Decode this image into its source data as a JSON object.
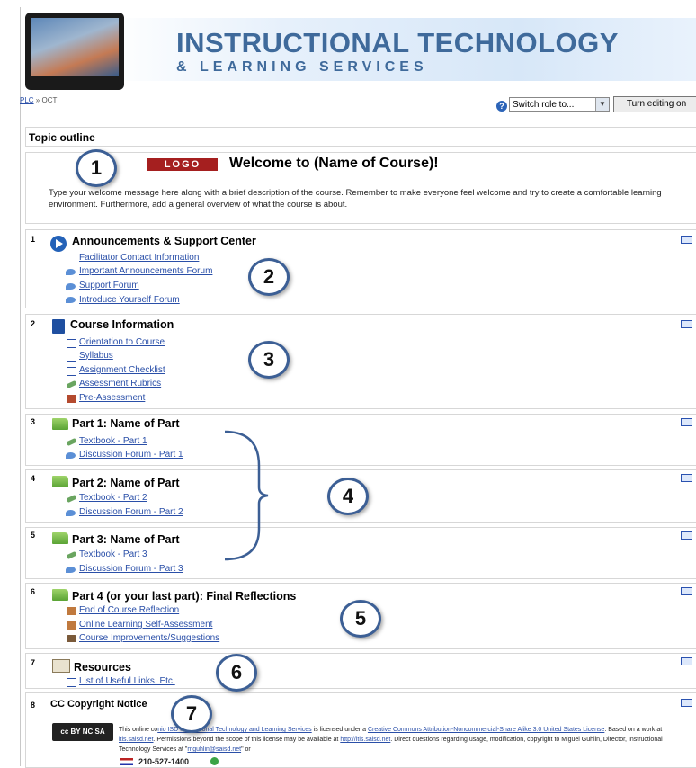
{
  "header": {
    "title_line1": "INSTRUCTIONAL TECHNOLOGY",
    "title_line2": "& LEARNING SERVICES"
  },
  "breadcrumb": {
    "items": [
      "PLC",
      "»",
      "OCT"
    ]
  },
  "toolbar": {
    "help_icon": "?",
    "role_select_value": "Switch role to...",
    "turn_editing_label": "Turn editing on"
  },
  "outline_title": "Topic outline",
  "welcome": {
    "logo_text": "LOGO",
    "title": "Welcome to (Name of Course)!",
    "message": "Type your welcome message here along with a brief description of the course. Remember to make everyone feel welcome and try to create a comfortable learning environment. Furthermore, add a general overview of what the course is about."
  },
  "badges": [
    "1",
    "2",
    "3",
    "4",
    "5",
    "6",
    "7"
  ],
  "sections": [
    {
      "num": "1",
      "title": "Announcements & Support Center",
      "items": [
        "Facilitator Contact Information",
        "Important Announcements Forum",
        "Support Forum",
        "Introduce Yourself Forum"
      ]
    },
    {
      "num": "2",
      "title": "Course Information",
      "items": [
        "Orientation to Course",
        "Syllabus",
        "Assignment Checklist",
        "Assessment Rubrics",
        "Pre-Assessment"
      ]
    },
    {
      "num": "3",
      "title": "Part 1: Name of Part",
      "items": [
        "Textbook - Part 1",
        "Discussion Forum - Part 1"
      ]
    },
    {
      "num": "4",
      "title": "Part 2: Name of Part",
      "items": [
        "Textbook - Part 2",
        "Discussion Forum - Part 2"
      ]
    },
    {
      "num": "5",
      "title": "Part 3: Name of Part",
      "items": [
        "Textbook - Part 3",
        "Discussion Forum - Part 3"
      ]
    },
    {
      "num": "6",
      "title": "Part 4 (or your last part): Final Reflections",
      "items": [
        "End of Course Reflection",
        "Online Learning Self-Assessment",
        "Course Improvements/Suggestions"
      ]
    },
    {
      "num": "7",
      "title": "Resources",
      "items": [
        "List of Useful Links, Etc."
      ]
    },
    {
      "num": "8",
      "title": "CC Copyright Notice",
      "items": []
    }
  ],
  "license": {
    "cc_badge": "cc BY NC SA",
    "text_1": "This online co",
    "link_1": "nio ISD Instructional Technology and Learning Services",
    "text_2": " is licensed under a ",
    "link_2": "Creative Commons Attribution-Noncommercial-Share Alike 3.0 United States License",
    "text_3": ". Based on a work at ",
    "link_3": "itls.saisd.net",
    "text_4": ". Permissions beyond the scope of this license may be available at ",
    "link_4": "http://itls.saisd.net",
    "text_5": ". Direct questions regarding usage, modification, copyright to Miguel Guhlin, Director, Instructional Technology Services at \"",
    "link_5": "mguhlin@saisd.net",
    "text_6": "\" or",
    "phone": "210-527-1400"
  }
}
